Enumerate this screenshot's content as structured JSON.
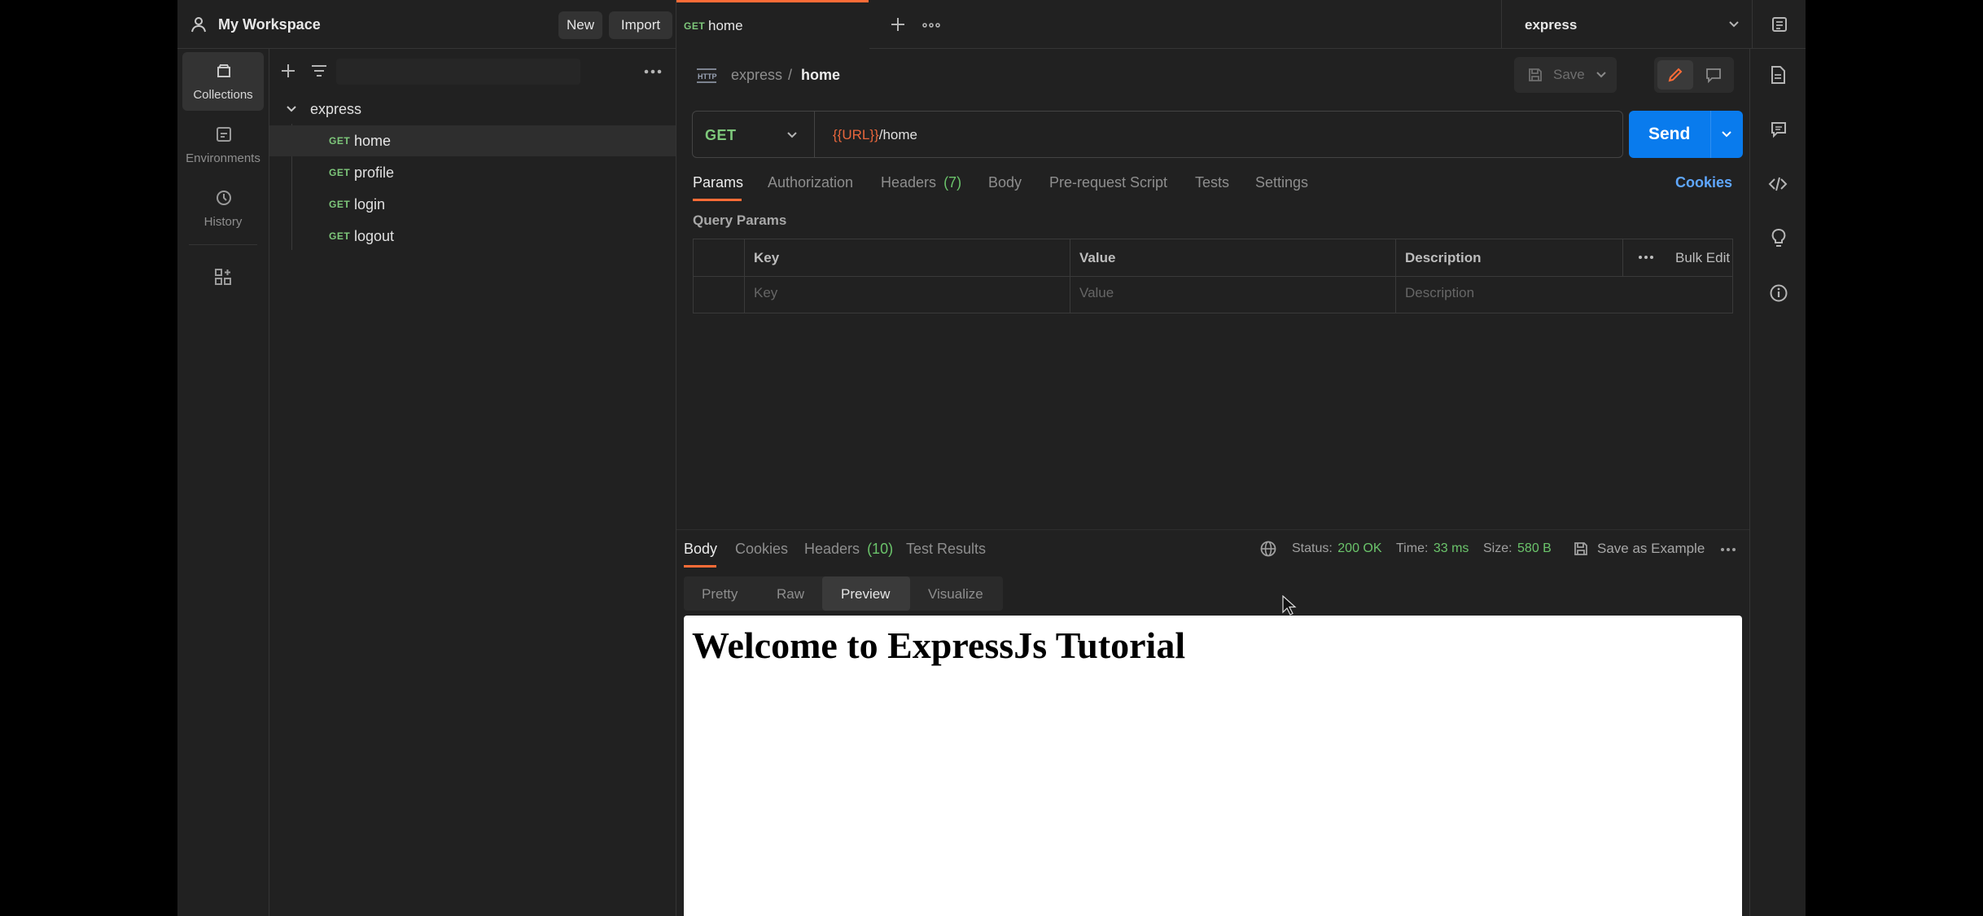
{
  "workspace": {
    "name": "My Workspace",
    "new_label": "New",
    "import_label": "Import"
  },
  "rail": {
    "items": [
      {
        "label": "Collections",
        "icon": "collections-icon",
        "active": true
      },
      {
        "label": "Environments",
        "icon": "environments-icon",
        "active": false
      },
      {
        "label": "History",
        "icon": "history-icon",
        "active": false
      }
    ]
  },
  "sidebar": {
    "collection_name": "express",
    "requests": [
      {
        "method": "GET",
        "name": "home",
        "selected": true
      },
      {
        "method": "GET",
        "name": "profile",
        "selected": false
      },
      {
        "method": "GET",
        "name": "login",
        "selected": false
      },
      {
        "method": "GET",
        "name": "logout",
        "selected": false
      }
    ]
  },
  "tabs": [
    {
      "method": "GET",
      "name": "home",
      "active": true
    }
  ],
  "environment": {
    "selected": "express"
  },
  "breadcrumb": {
    "collection": "express",
    "separator": "/",
    "request": "home",
    "save_label": "Save"
  },
  "request": {
    "method": "GET",
    "url_variable": "{{URL}}",
    "url_path": "/home",
    "send_label": "Send",
    "tabs": [
      {
        "label": "Params",
        "count": "",
        "active": true
      },
      {
        "label": "Authorization",
        "count": "",
        "active": false
      },
      {
        "label": "Headers",
        "count": "(7)",
        "active": false
      },
      {
        "label": "Body",
        "count": "",
        "active": false
      },
      {
        "label": "Pre-request Script",
        "count": "",
        "active": false
      },
      {
        "label": "Tests",
        "count": "",
        "active": false
      },
      {
        "label": "Settings",
        "count": "",
        "active": false
      }
    ],
    "cookies_label": "Cookies",
    "query_params_title": "Query Params",
    "table": {
      "headers": {
        "key": "Key",
        "value": "Value",
        "description": "Description",
        "bulk_edit": "Bulk Edit"
      },
      "placeholders": {
        "key": "Key",
        "value": "Value",
        "description": "Description"
      }
    }
  },
  "response": {
    "tabs": [
      {
        "label": "Body",
        "count": "",
        "active": true
      },
      {
        "label": "Cookies",
        "count": "",
        "active": false
      },
      {
        "label": "Headers",
        "count": "(10)",
        "active": false
      },
      {
        "label": "Test Results",
        "count": "",
        "active": false
      }
    ],
    "status_label": "Status:",
    "status_value": "200 OK",
    "time_label": "Time:",
    "time_value": "33 ms",
    "size_label": "Size:",
    "size_value": "580 B",
    "save_example_label": "Save as Example",
    "view_modes": [
      {
        "label": "Pretty",
        "active": false
      },
      {
        "label": "Raw",
        "active": false
      },
      {
        "label": "Preview",
        "active": true
      },
      {
        "label": "Visualize",
        "active": false
      }
    ],
    "preview_heading": "Welcome to ExpressJs Tutorial"
  },
  "colors": {
    "accent": "#ff6c37",
    "send": "#097bed",
    "get_method": "#7ec87b",
    "status_ok": "#6bc46b",
    "cookies_link": "#5fa7ff",
    "url_variable": "#e8663c"
  }
}
